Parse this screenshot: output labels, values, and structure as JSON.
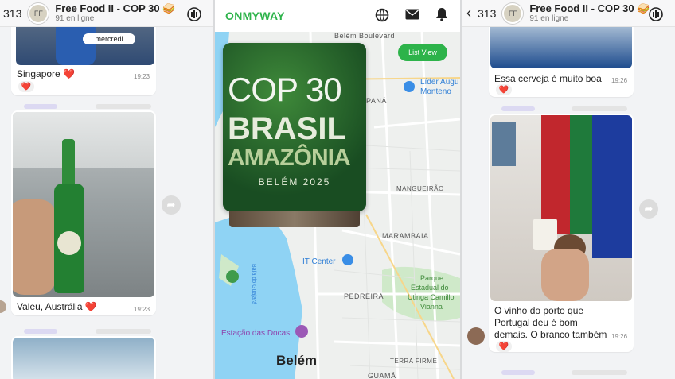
{
  "left_chat": {
    "header": {
      "count": "313",
      "title": "Free Food II - COP 30 🥪",
      "subtitle": "91 en ligne"
    },
    "messages": [
      {
        "date_badge": "mercredi",
        "caption": "Singapore ❤️",
        "time": "19:23",
        "reaction": "❤️"
      },
      {
        "caption": "Valeu, Austrália ❤️",
        "time": "19:23"
      }
    ]
  },
  "map_app": {
    "logo": "ONMYWAY",
    "list_view_button": "List View",
    "card": {
      "line1": "COP 30",
      "line2": "BRASIL",
      "line3": "AMAZÔNIA",
      "line4": "BELÉM 2025"
    },
    "labels": {
      "belem_cidade": "Belém Boulevard",
      "lider": "Líder Augu",
      "monteiro": "Monteno",
      "panau": "PANÁ",
      "mangueirao": "MANGUEIRÃO",
      "marambaia": "MARAMBAIA",
      "it_center": "IT Center",
      "parque": "Parque",
      "estadual": "Estadual do",
      "utinga": "Utinga Camillo",
      "vianna": "Vianna",
      "pedreira": "PEDREIRA",
      "estacao": "Estação das Docas",
      "belem": "Belém",
      "terra_firme": "TERRA FIRME",
      "guama": "GUAMÁ",
      "baia": "Baía do Guajará"
    },
    "colors": {
      "brand": "#2db34a",
      "water": "#8fd3f4",
      "park": "#cfe9c9"
    }
  },
  "right_chat": {
    "header": {
      "count": "313",
      "title": "Free Food II - COP 30 🥪",
      "subtitle": "91 en ligne"
    },
    "messages": [
      {
        "caption": "Essa cerveja é muito boa",
        "time": "19:26",
        "reaction": "❤️"
      },
      {
        "caption": "O vinho do porto que Portugal deu é bom demais. O branco também",
        "time": "19:26",
        "reaction": "❤️"
      }
    ]
  }
}
